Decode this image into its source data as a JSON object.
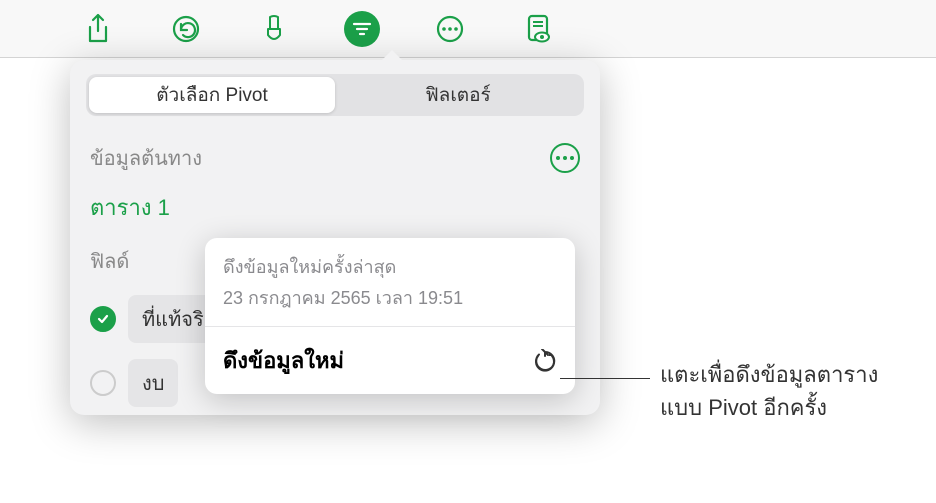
{
  "toolbar": {
    "share_icon": "share-icon",
    "undo_icon": "undo-icon",
    "format_icon": "format-brush-icon",
    "organize_icon": "organize-icon",
    "more_icon": "more-icon",
    "preview_icon": "document-preview-icon"
  },
  "popover": {
    "tabs": {
      "pivot_options": "ตัวเลือก Pivot",
      "filters": "ฟิลเตอร์"
    },
    "source_data_label": "ข้อมูลต้นทาง",
    "source_table": "ตาราง 1",
    "fields_label": "ฟิลด์",
    "fields": [
      {
        "label": "ที่แท้จริง",
        "checked": true
      },
      {
        "label": "งบ",
        "checked": false
      }
    ]
  },
  "refresh_card": {
    "last_refresh_label": "ดึงข้อมูลใหม่ครั้งล่าสุด",
    "last_refresh_date": "23 กรกฎาคม 2565 เวลา 19:51",
    "refresh_button": "ดึงข้อมูลใหม่"
  },
  "callout": {
    "line1": "แตะเพื่อดึงข้อมูลตาราง",
    "line2": "แบบ Pivot อีกครั้ง"
  }
}
